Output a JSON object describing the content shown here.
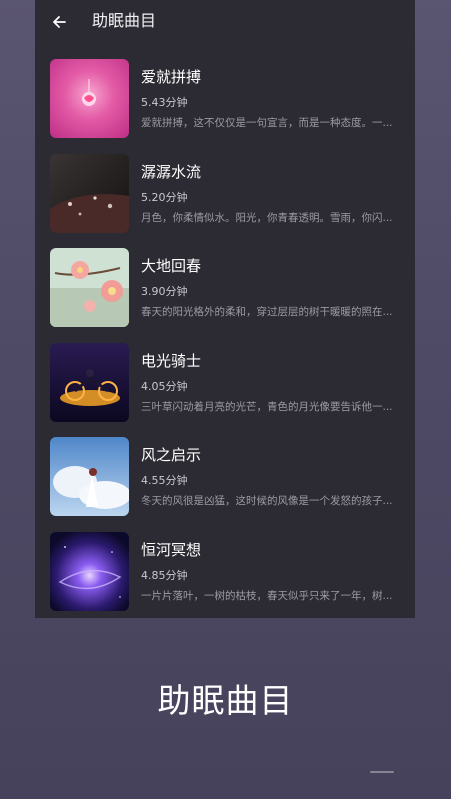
{
  "header": {
    "title": "助眠曲目"
  },
  "tracks": [
    {
      "name": "爱就拼搏",
      "duration": "5.43分钟",
      "description": "爱就拼搏，这不仅仅是一句宣言，而是一种态度。一..."
    },
    {
      "name": "潺潺水流",
      "duration": "5.20分钟",
      "description": "月色，你柔情似水。阳光，你青春透明。雪雨，你闪..."
    },
    {
      "name": "大地回春",
      "duration": "3.90分钟",
      "description": "春天的阳光格外的柔和，穿过层层的树干暖暖的照在..."
    },
    {
      "name": "电光骑士",
      "duration": "4.05分钟",
      "description": "三叶草闪动着月亮的光芒，青色的月光像要告诉他一..."
    },
    {
      "name": "风之启示",
      "duration": "4.55分钟",
      "description": "冬天的风很是凶猛，这时候的风像是一个发怒的孩子..."
    },
    {
      "name": "恒河冥想",
      "duration": "4.85分钟",
      "description": "一片片落叶，一树的枯枝，春天似乎只来了一年，树..."
    }
  ],
  "caption": "助眠曲目"
}
